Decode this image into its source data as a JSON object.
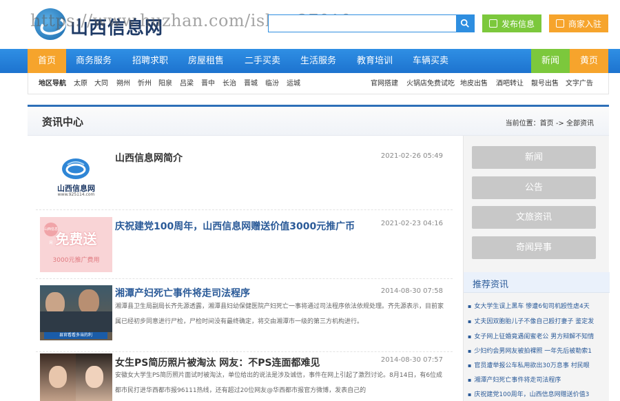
{
  "header": {
    "logo_text": "山西信息网",
    "logo_sub": "www.925114.com",
    "watermark": "https://www.huzhan.com/ishop27010",
    "search_placeholder": "",
    "post_label": "发布信息",
    "merchant_label": "商家入驻"
  },
  "nav": {
    "items": [
      "首页",
      "商务服务",
      "招聘求职",
      "房屋租售",
      "二手买卖",
      "生活服务",
      "教育培训",
      "车辆买卖"
    ],
    "right": [
      "新闻",
      "黄页"
    ]
  },
  "subnav": {
    "region_label": "地区导航",
    "regions": [
      "太原",
      "大同",
      "朔州",
      "忻州",
      "阳泉",
      "吕梁",
      "晋中",
      "长治",
      "晋城",
      "临汾",
      "运城"
    ],
    "links": [
      "官网搭建",
      "火锅店免费试吃",
      "地皮出售",
      "酒吧转让",
      "靓号出售",
      "文字广告"
    ]
  },
  "content": {
    "title": "资讯中心",
    "crumb": "当前位置：首页 -> 全部资讯"
  },
  "articles": [
    {
      "title": "山西信息网简介",
      "date": "2021-02-26 05:49",
      "desc": ""
    },
    {
      "title": "庆祝建党100周年，山西信息网赠送价值3000元推广币",
      "date": "2021-02-23 04:16",
      "desc": ""
    },
    {
      "title": "湘潭产妇死亡事件将走司法程序",
      "date": "2014-08-30 07:58",
      "desc": "湘潭县卫生局副局长齐先源透露，湘潭县妇幼保健医院产妇死亡一事将通过司法程序依法依规处理。齐先源表示，目前家属已经初步同意进行尸检，尸检时间没有最终确定，将交由湘潭市一级的第三方机构进行。"
    },
    {
      "title": "女生PS简历照片被淘汰 网友：不PS连面都难见",
      "date": "2014-08-30 07:57",
      "desc": "安徽女大学生PS简历照片面试时被淘汰，单位给出的说法是涉及诚信，事件在网上引起了激烈讨论。8月14日，有6位成都市民打进华西都市报96111热线，还有超过20位网友@华西都市报官方微博，发表自己的"
    }
  ],
  "thumbs": {
    "logo_caption": "山西信息网",
    "logo_url_caption": "www.925114.com",
    "promo_main": "免费送",
    "promo_sub": "3000元推广费用",
    "promo_badge": "山西信息网",
    "tv_caption": "县官看看多当的利"
  },
  "sidebar": {
    "buttons": [
      "新闻",
      "公告",
      "文旅资讯",
      "奇闻异事"
    ],
    "rec_title": "推荐资讯",
    "rec_items": [
      "女大学生误上黑车 惨遭6旬司机殴性虐4天",
      "丈夫因双胞胎儿子不像自己殴打妻子 鉴定发",
      "女子网上征婚竟遇闺蜜老公 男方辩解不知情",
      "少妇约会男网友被拍裸照 一年先后被勒索1",
      "官员遭举报公车私用欲出30万息事 村民眼",
      "湘潭产妇死亡事件将走司法程序",
      "庆祝建党100周年，山西信息网赠送价值3"
    ]
  },
  "colors": {
    "nav_blue": "#2f8fe4",
    "accent_orange": "#f6a42c",
    "accent_green": "#7cc83c",
    "link_blue": "#2a5a98"
  }
}
